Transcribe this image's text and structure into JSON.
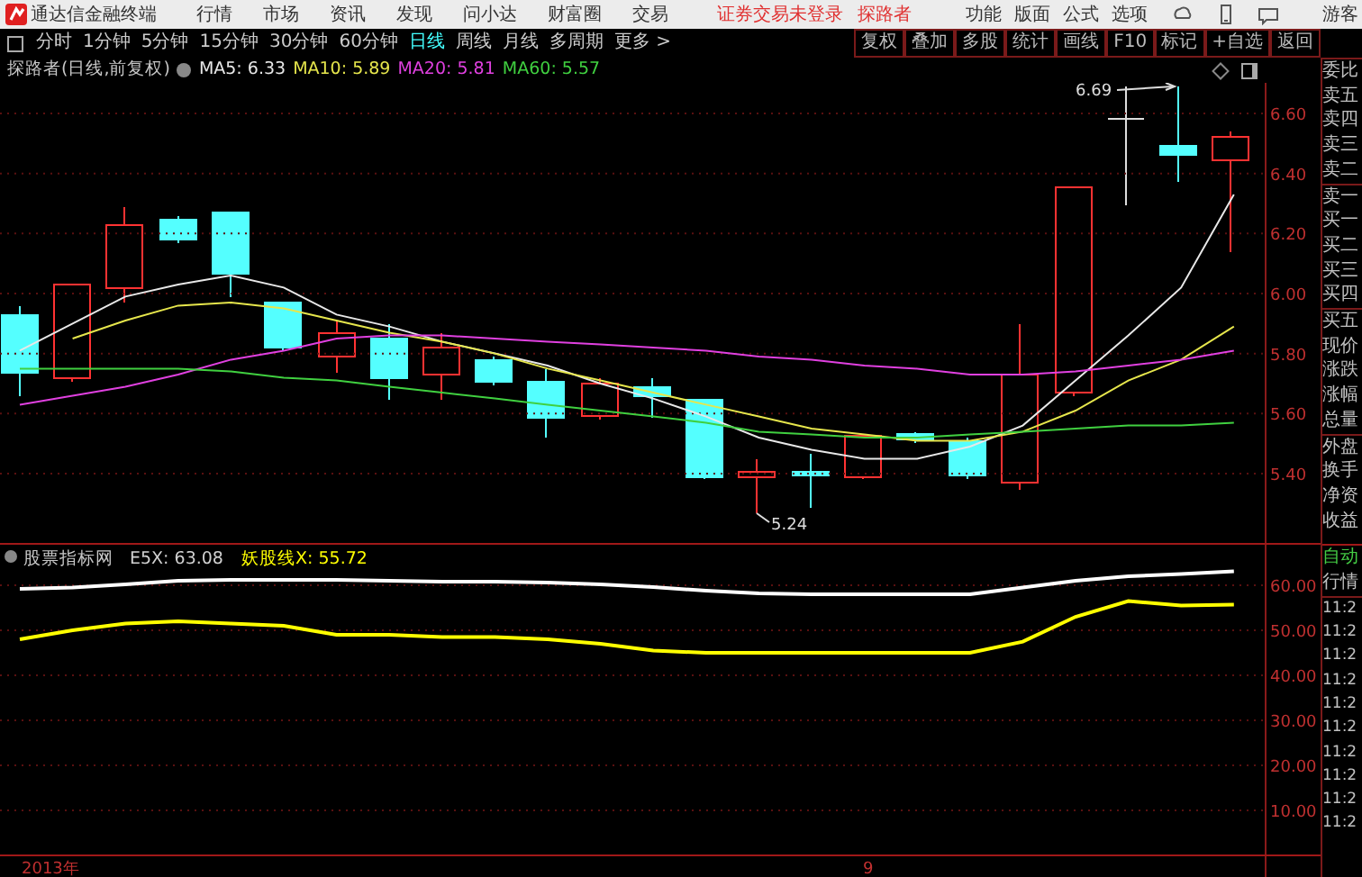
{
  "title_bar": {
    "app_name": "通达信金融终端",
    "menu": [
      "行情",
      "市场",
      "资讯",
      "发现",
      "问小达",
      "财富圈",
      "交易"
    ],
    "login_status": "证券交易未登录",
    "stock": "探路者",
    "tools": [
      "功能",
      "版面",
      "公式",
      "选项"
    ],
    "user": "游客"
  },
  "period_tabs": [
    {
      "label": "分时",
      "selected": false
    },
    {
      "label": "1分钟",
      "selected": false
    },
    {
      "label": "5分钟",
      "selected": false
    },
    {
      "label": "15分钟",
      "selected": false
    },
    {
      "label": "30分钟",
      "selected": false
    },
    {
      "label": "60分钟",
      "selected": false
    },
    {
      "label": "日线",
      "selected": true
    },
    {
      "label": "周线",
      "selected": false
    },
    {
      "label": "月线",
      "selected": false
    },
    {
      "label": "多周期",
      "selected": false
    },
    {
      "label": "更多 >",
      "selected": false
    }
  ],
  "chart_tools": [
    "复权",
    "叠加",
    "多股",
    "统计",
    "画线",
    "F10",
    "标记",
    "+自选",
    "返回"
  ],
  "price_chart": {
    "title": "探路者(日线,前复权)",
    "high_label": "6.69",
    "low_label": "5.24",
    "chart_data": {
      "type": "line",
      "ylim": [
        5.4,
        6.6
      ],
      "grid": true,
      "yticks": [
        {
          "value": 6.6,
          "label": "6.60"
        },
        {
          "value": 6.4,
          "label": "6.40"
        },
        {
          "value": 6.2,
          "label": "6.20"
        },
        {
          "value": 6.0,
          "label": "6.00"
        },
        {
          "value": 5.8,
          "label": "5.80"
        },
        {
          "value": 5.6,
          "label": "5.60"
        },
        {
          "value": 5.4,
          "label": "5.40"
        }
      ],
      "series": [
        {
          "name": "MA5: 6.33",
          "color": "#e8e8e8",
          "values": [
            5.81,
            5.9,
            5.99,
            6.03,
            6.06,
            6.02,
            5.93,
            5.89,
            5.84,
            5.8,
            5.76,
            5.7,
            5.65,
            5.59,
            5.52,
            5.48,
            5.45,
            5.45,
            5.49,
            5.56,
            5.71,
            5.86,
            6.02,
            6.33
          ]
        },
        {
          "name": "MA10: 5.89",
          "color": "#e6e64c",
          "values": [
            null,
            5.85,
            5.91,
            5.96,
            5.97,
            5.95,
            5.91,
            5.87,
            5.84,
            5.8,
            5.75,
            5.71,
            5.67,
            5.63,
            5.59,
            5.55,
            5.53,
            5.51,
            5.51,
            5.54,
            5.61,
            5.71,
            5.78,
            5.89
          ]
        },
        {
          "name": "MA20: 5.81",
          "color": "#e040e0",
          "values": [
            5.63,
            5.66,
            5.69,
            5.73,
            5.78,
            5.81,
            5.85,
            5.86,
            5.86,
            5.85,
            5.84,
            5.83,
            5.82,
            5.81,
            5.79,
            5.78,
            5.76,
            5.75,
            5.73,
            5.73,
            5.74,
            5.76,
            5.78,
            5.81
          ]
        },
        {
          "name": "MA60: 5.57",
          "color": "#40d040",
          "values": [
            5.75,
            5.75,
            5.75,
            5.75,
            5.74,
            5.72,
            5.71,
            5.69,
            5.67,
            5.65,
            5.63,
            5.61,
            5.59,
            5.57,
            5.54,
            5.53,
            5.52,
            5.52,
            5.53,
            5.54,
            5.55,
            5.56,
            5.56,
            5.57
          ]
        }
      ]
    }
  },
  "indicator": {
    "name": "股票指标网",
    "chart_data": {
      "type": "line",
      "ylim": [
        -4.8,
        69.2
      ],
      "grid": true,
      "yticks": [
        {
          "value": 60,
          "label": "60.00"
        },
        {
          "value": 50,
          "label": "50.00"
        },
        {
          "value": 40,
          "label": "40.00"
        },
        {
          "value": 30,
          "label": "30.00"
        },
        {
          "value": 20,
          "label": "20.00"
        },
        {
          "value": 10,
          "label": "10.00"
        }
      ],
      "series": [
        {
          "name": "E5X: 63.08",
          "color": "#ffffff",
          "values": [
            59.2,
            59.5,
            60.2,
            61,
            61.2,
            61.2,
            61.2,
            61,
            60.8,
            60.8,
            60.6,
            60.2,
            59.6,
            58.8,
            58.2,
            58,
            58,
            58,
            58,
            59.5,
            61,
            62,
            62.5,
            63.08
          ]
        },
        {
          "name": "妖股线X: 55.72",
          "color": "#ffff00",
          "values": [
            48,
            50,
            51.5,
            52,
            51.5,
            51,
            49,
            49,
            48.5,
            48.5,
            48,
            47,
            45.5,
            45,
            45,
            45,
            45,
            45,
            45,
            47.5,
            53,
            56.5,
            55.5,
            55.72
          ]
        }
      ]
    }
  },
  "time_axis": [
    "2013年",
    "9"
  ],
  "side_panel": {
    "quote_labels": [
      "委比",
      "卖五",
      "卖四",
      "卖三",
      "卖二",
      "卖一",
      "买一",
      "买二",
      "买三",
      "买四",
      "买五",
      "现价",
      "涨跌",
      "涨幅",
      "总量",
      "外盘",
      "换手",
      "净资",
      "收益"
    ],
    "mode": "自动",
    "section": "行情",
    "times": [
      "11:2",
      "11:2",
      "11:2",
      "11:2",
      "11:2",
      "11:2",
      "11:2",
      "11:2",
      "11:2",
      "11:2"
    ]
  }
}
